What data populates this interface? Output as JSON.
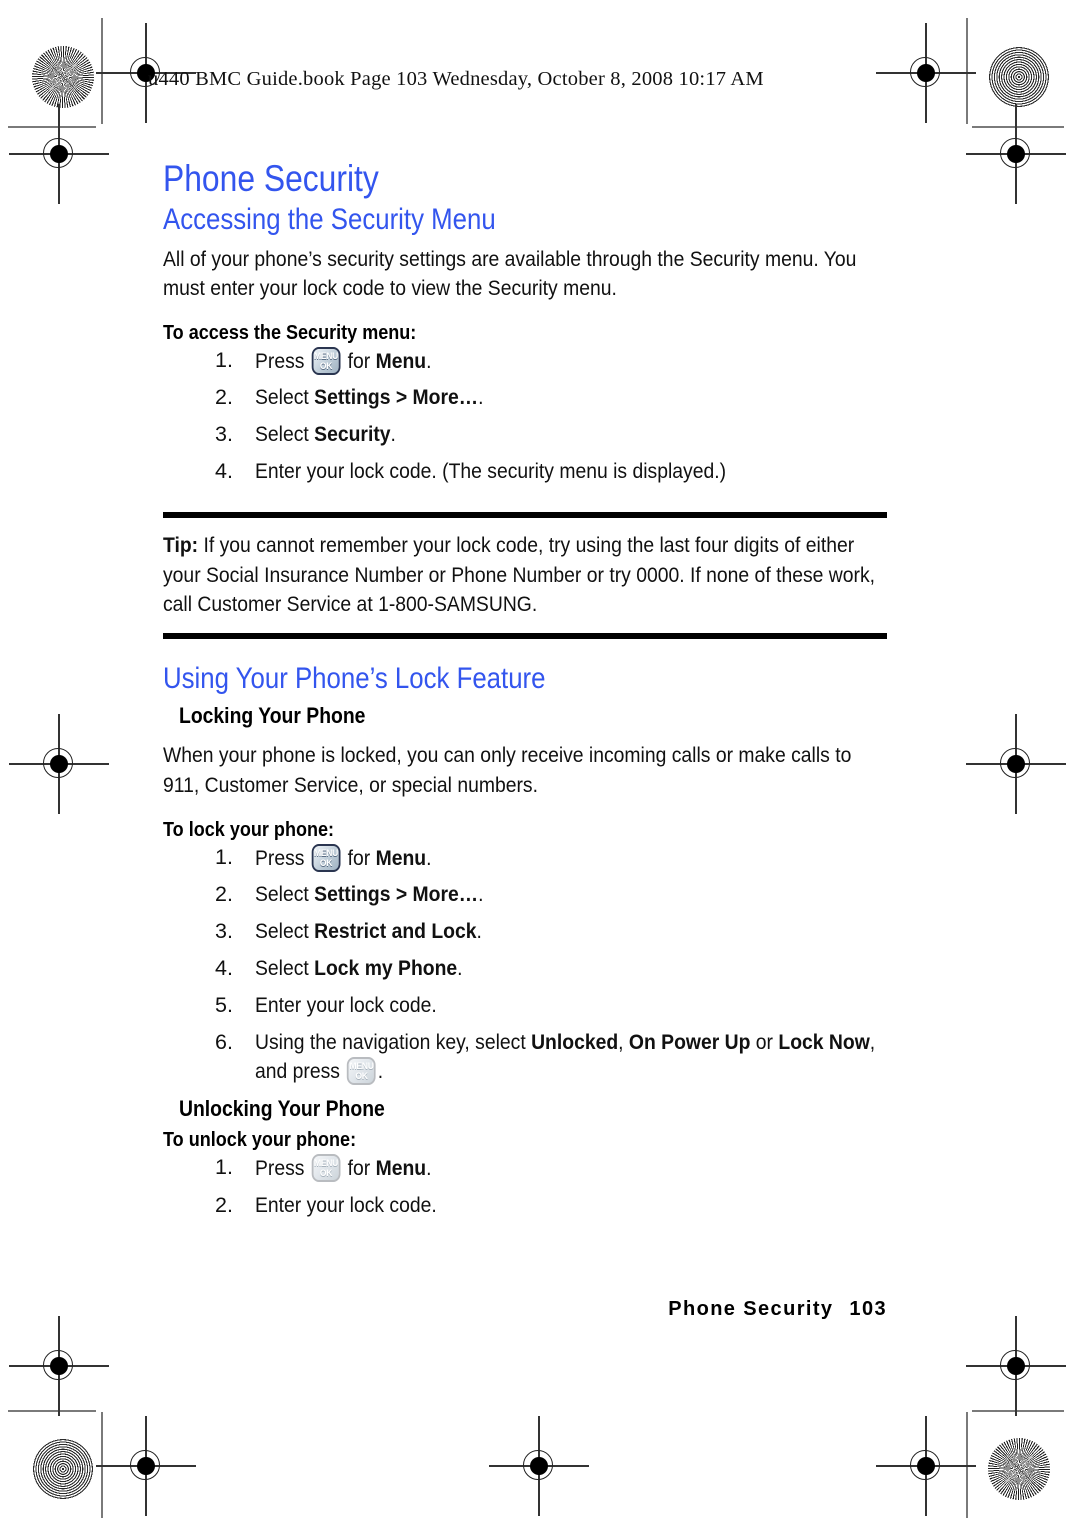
{
  "header": {
    "running_head": "u440 BMC Guide.book  Page 103  Wednesday, October 8, 2008  10:17 AM"
  },
  "colors": {
    "heading_blue": "#3355ee",
    "body_black": "#111111",
    "rule_black": "#000000",
    "key_border": "#2a3550"
  },
  "key_icon": {
    "line1": "MENU",
    "line2": "OK",
    "name": "menu-ok-key-icon"
  },
  "title": "Phone Security",
  "sections": [
    {
      "heading": "Accessing the Security Menu",
      "intro": "All of your phone’s security settings are available through the Security menu. You must enter your lock code to view the Security menu.",
      "proc_title": "To access the Security menu:",
      "steps": [
        {
          "num": "1.",
          "pre": "Press ",
          "key": true,
          "post_plain": " for ",
          "post_bold": "Menu",
          "tail": "."
        },
        {
          "num": "2.",
          "pre": "Select ",
          "key": false,
          "post_bold": "Settings > More…",
          "tail": "."
        },
        {
          "num": "3.",
          "pre": "Select ",
          "key": false,
          "post_bold": "Security",
          "tail": "."
        },
        {
          "num": "4.",
          "pre": "Enter your lock code. (The security menu is displayed.)",
          "key": false,
          "post_bold": "",
          "tail": ""
        }
      ]
    }
  ],
  "tip": {
    "label": "Tip:",
    "text": " If you cannot remember your lock code, try using the last four digits of either your Social Insurance Number or Phone Number or try 0000. If none of these work, call Customer Service at 1-800-SAMSUNG."
  },
  "section2": {
    "heading": "Using Your Phone’s Lock Feature",
    "sub1": "Locking Your Phone",
    "sub1_body": "When your phone is locked, you can only receive incoming calls or make calls to 911, Customer Service, or special numbers.",
    "proc1_title": "To lock your phone:",
    "proc1_steps": [
      {
        "num": "1.",
        "pre": "Press ",
        "key": true,
        "post_plain": " for ",
        "post_bold": "Menu",
        "tail": "."
      },
      {
        "num": "2.",
        "pre": "Select ",
        "key": false,
        "post_bold": "Settings > More…",
        "tail": "."
      },
      {
        "num": "3.",
        "pre": "Select ",
        "key": false,
        "post_bold": "Restrict and Lock",
        "tail": "."
      },
      {
        "num": "4.",
        "pre": "Select ",
        "key": false,
        "post_bold": "Lock my Phone",
        "tail": "."
      },
      {
        "num": "5.",
        "pre": "Enter your lock code.",
        "key": false,
        "post_bold": "",
        "tail": ""
      }
    ],
    "step6": {
      "num": "6.",
      "pre": "Using the navigation key, select ",
      "opt1": "Unlocked",
      "sep1": ", ",
      "opt2": "On Power Up",
      "sep2": " or ",
      "opt3": "Lock Now",
      "mid": ", and press ",
      "tail": "."
    },
    "sub2": "Unlocking Your Phone",
    "proc2_title": "To unlock your phone:",
    "proc2_steps": [
      {
        "num": "1.",
        "pre": "Press ",
        "key": true,
        "post_plain": " for ",
        "post_bold": "Menu",
        "tail": "."
      },
      {
        "num": "2.",
        "pre": "Enter your lock code.",
        "key": false,
        "post_bold": "",
        "tail": ""
      }
    ]
  },
  "footer": {
    "section_name": "Phone Security",
    "page_number": "103"
  }
}
